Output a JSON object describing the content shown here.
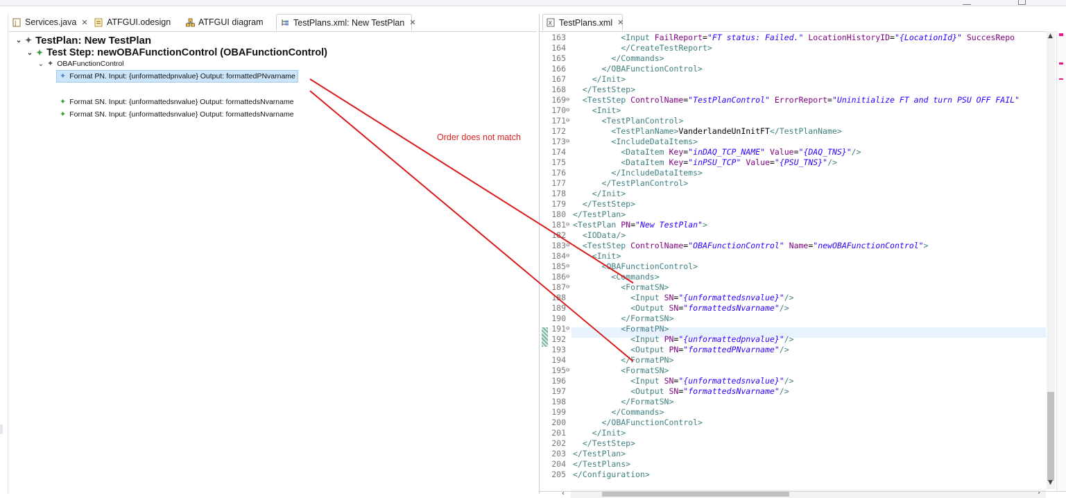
{
  "left_tabs": [
    {
      "label": "Services.java",
      "icon": "java-file-icon"
    },
    {
      "label": "ATFGUI.odesign",
      "icon": "odesign-file-icon"
    },
    {
      "label": "ATFGUI diagram",
      "icon": "diagram-icon"
    },
    {
      "label": "TestPlans.xml: New TestPlan",
      "icon": "tree-editor-icon"
    }
  ],
  "right_tab": {
    "label": "TestPlans.xml",
    "icon": "xml-file-icon"
  },
  "tree": {
    "testplan": "TestPlan: New TestPlan",
    "teststep": "Test Step: newOBAFunctionControl (OBAFunctionControl)",
    "control": "OBAFunctionControl",
    "commands": [
      "Format PN. Input: {unformattedpnvalue} Output: formattedPNvarname",
      "Format SN. Input: {unformattedsnvalue} Output: formattedsNvarname",
      "Format SN. Input: {unformattedsnvalue} Output: formattedsNvarname"
    ]
  },
  "annotation": "Order does not match",
  "code": {
    "lines": [
      {
        "n": "163",
        "f": "",
        "c": [
          [
            "x",
            "          "
          ],
          [
            "t",
            "<Input "
          ],
          [
            "a",
            "FailReport"
          ],
          [
            "x",
            "="
          ],
          [
            "v",
            "\"FT status: Failed.\""
          ],
          [
            "x",
            " "
          ],
          [
            "a",
            "LocationHistoryID"
          ],
          [
            "x",
            "="
          ],
          [
            "v",
            "\"{LocationId}\""
          ],
          [
            "x",
            " "
          ],
          [
            "a",
            "SuccesRepo"
          ]
        ]
      },
      {
        "n": "164",
        "f": "",
        "c": [
          [
            "x",
            "          "
          ],
          [
            "t",
            "</CreateTestReport>"
          ]
        ]
      },
      {
        "n": "165",
        "f": "",
        "c": [
          [
            "x",
            "        "
          ],
          [
            "t",
            "</Commands>"
          ]
        ]
      },
      {
        "n": "166",
        "f": "",
        "c": [
          [
            "x",
            "      "
          ],
          [
            "t",
            "</OBAFunctionControl>"
          ]
        ]
      },
      {
        "n": "167",
        "f": "",
        "c": [
          [
            "x",
            "    "
          ],
          [
            "t",
            "</Init>"
          ]
        ]
      },
      {
        "n": "168",
        "f": "",
        "c": [
          [
            "x",
            "  "
          ],
          [
            "t",
            "</TestStep>"
          ]
        ]
      },
      {
        "n": "169",
        "f": "⊖",
        "c": [
          [
            "x",
            "  "
          ],
          [
            "t",
            "<TestStep "
          ],
          [
            "a",
            "ControlName"
          ],
          [
            "x",
            "="
          ],
          [
            "v",
            "\"TestPlanControl\""
          ],
          [
            "x",
            " "
          ],
          [
            "a",
            "ErrorReport"
          ],
          [
            "x",
            "="
          ],
          [
            "v",
            "\"Uninitialize FT and turn PSU OFF FAIL\""
          ]
        ]
      },
      {
        "n": "170",
        "f": "⊖",
        "c": [
          [
            "x",
            "    "
          ],
          [
            "t",
            "<Init>"
          ]
        ]
      },
      {
        "n": "171",
        "f": "⊖",
        "c": [
          [
            "x",
            "      "
          ],
          [
            "t",
            "<TestPlanControl>"
          ]
        ]
      },
      {
        "n": "172",
        "f": "",
        "c": [
          [
            "x",
            "        "
          ],
          [
            "t",
            "<TestPlanName>"
          ],
          [
            "x",
            "VanderlandeUnInitFT"
          ],
          [
            "t",
            "</TestPlanName>"
          ]
        ]
      },
      {
        "n": "173",
        "f": "⊖",
        "c": [
          [
            "x",
            "        "
          ],
          [
            "t",
            "<IncludeDataItems>"
          ]
        ]
      },
      {
        "n": "174",
        "f": "",
        "c": [
          [
            "x",
            "          "
          ],
          [
            "t",
            "<DataItem "
          ],
          [
            "a",
            "Key"
          ],
          [
            "x",
            "="
          ],
          [
            "v",
            "\"inDAQ_TCP_NAME\""
          ],
          [
            "x",
            " "
          ],
          [
            "a",
            "Value"
          ],
          [
            "x",
            "="
          ],
          [
            "v",
            "\"{DAQ_TNS}\""
          ],
          [
            "t",
            "/>"
          ]
        ]
      },
      {
        "n": "175",
        "f": "",
        "c": [
          [
            "x",
            "          "
          ],
          [
            "t",
            "<DataItem "
          ],
          [
            "a",
            "Key"
          ],
          [
            "x",
            "="
          ],
          [
            "v",
            "\"inPSU_TCP\""
          ],
          [
            "x",
            " "
          ],
          [
            "a",
            "Value"
          ],
          [
            "x",
            "="
          ],
          [
            "v",
            "\"{PSU_TNS}\""
          ],
          [
            "t",
            "/>"
          ]
        ]
      },
      {
        "n": "176",
        "f": "",
        "c": [
          [
            "x",
            "        "
          ],
          [
            "t",
            "</IncludeDataItems>"
          ]
        ]
      },
      {
        "n": "177",
        "f": "",
        "c": [
          [
            "x",
            "      "
          ],
          [
            "t",
            "</TestPlanControl>"
          ]
        ]
      },
      {
        "n": "178",
        "f": "",
        "c": [
          [
            "x",
            "    "
          ],
          [
            "t",
            "</Init>"
          ]
        ]
      },
      {
        "n": "179",
        "f": "",
        "c": [
          [
            "x",
            "  "
          ],
          [
            "t",
            "</TestStep>"
          ]
        ]
      },
      {
        "n": "180",
        "f": "",
        "c": [
          [
            "t",
            "</TestPlan>"
          ]
        ]
      },
      {
        "n": "181",
        "f": "⊖",
        "c": [
          [
            "t",
            "<TestPlan "
          ],
          [
            "a",
            "PN"
          ],
          [
            "x",
            "="
          ],
          [
            "v",
            "\"New TestPlan\""
          ],
          [
            "t",
            ">"
          ]
        ]
      },
      {
        "n": "182",
        "f": "",
        "c": [
          [
            "x",
            "  "
          ],
          [
            "t",
            "<IOData/>"
          ]
        ]
      },
      {
        "n": "183",
        "f": "⊖",
        "c": [
          [
            "x",
            "  "
          ],
          [
            "t",
            "<TestStep "
          ],
          [
            "a",
            "ControlName"
          ],
          [
            "x",
            "="
          ],
          [
            "v",
            "\"OBAFunctionControl\""
          ],
          [
            "x",
            " "
          ],
          [
            "a",
            "Name"
          ],
          [
            "x",
            "="
          ],
          [
            "v",
            "\"newOBAFunctionControl\""
          ],
          [
            "t",
            ">"
          ]
        ]
      },
      {
        "n": "184",
        "f": "⊖",
        "c": [
          [
            "x",
            "    "
          ],
          [
            "t",
            "<Init>"
          ]
        ]
      },
      {
        "n": "185",
        "f": "⊖",
        "c": [
          [
            "x",
            "      "
          ],
          [
            "t",
            "<OBAFunctionControl>"
          ]
        ]
      },
      {
        "n": "186",
        "f": "⊖",
        "c": [
          [
            "x",
            "        "
          ],
          [
            "t",
            "<Commands>"
          ]
        ]
      },
      {
        "n": "187",
        "f": "⊖",
        "c": [
          [
            "x",
            "          "
          ],
          [
            "t",
            "<FormatSN>"
          ]
        ]
      },
      {
        "n": "188",
        "f": "",
        "c": [
          [
            "x",
            "            "
          ],
          [
            "t",
            "<Input "
          ],
          [
            "a",
            "SN"
          ],
          [
            "x",
            "="
          ],
          [
            "v",
            "\"{unformattedsnvalue}\""
          ],
          [
            "t",
            "/>"
          ]
        ]
      },
      {
        "n": "189",
        "f": "",
        "c": [
          [
            "x",
            "            "
          ],
          [
            "t",
            "<Output "
          ],
          [
            "a",
            "SN"
          ],
          [
            "x",
            "="
          ],
          [
            "v",
            "\"formattedsNvarname\""
          ],
          [
            "t",
            "/>"
          ]
        ]
      },
      {
        "n": "190",
        "f": "",
        "c": [
          [
            "x",
            "          "
          ],
          [
            "t",
            "</FormatSN>"
          ]
        ]
      },
      {
        "n": "191",
        "f": "⊖",
        "c": [
          [
            "x",
            "          "
          ],
          [
            "t",
            "<FormatPN>"
          ]
        ]
      },
      {
        "n": "192",
        "f": "",
        "c": [
          [
            "x",
            "            "
          ],
          [
            "t",
            "<Input "
          ],
          [
            "a",
            "PN"
          ],
          [
            "x",
            "="
          ],
          [
            "v",
            "\"{unformattedpnvalue}\""
          ],
          [
            "t",
            "/>"
          ]
        ]
      },
      {
        "n": "193",
        "f": "",
        "c": [
          [
            "x",
            "            "
          ],
          [
            "t",
            "<Output "
          ],
          [
            "a",
            "PN"
          ],
          [
            "x",
            "="
          ],
          [
            "v",
            "\"formattedPNvarname\""
          ],
          [
            "t",
            "/>"
          ]
        ]
      },
      {
        "n": "194",
        "f": "",
        "c": [
          [
            "x",
            "          "
          ],
          [
            "t",
            "</FormatPN>"
          ]
        ]
      },
      {
        "n": "195",
        "f": "⊖",
        "c": [
          [
            "x",
            "          "
          ],
          [
            "t",
            "<FormatSN>"
          ]
        ]
      },
      {
        "n": "196",
        "f": "",
        "c": [
          [
            "x",
            "            "
          ],
          [
            "t",
            "<Input "
          ],
          [
            "a",
            "SN"
          ],
          [
            "x",
            "="
          ],
          [
            "v",
            "\"{unformattedsnvalue}\""
          ],
          [
            "t",
            "/>"
          ]
        ]
      },
      {
        "n": "197",
        "f": "",
        "c": [
          [
            "x",
            "            "
          ],
          [
            "t",
            "<Output "
          ],
          [
            "a",
            "SN"
          ],
          [
            "x",
            "="
          ],
          [
            "v",
            "\"formattedsNvarname\""
          ],
          [
            "t",
            "/>"
          ]
        ]
      },
      {
        "n": "198",
        "f": "",
        "c": [
          [
            "x",
            "          "
          ],
          [
            "t",
            "</FormatSN>"
          ]
        ]
      },
      {
        "n": "199",
        "f": "",
        "c": [
          [
            "x",
            "        "
          ],
          [
            "t",
            "</Commands>"
          ]
        ]
      },
      {
        "n": "200",
        "f": "",
        "c": [
          [
            "x",
            "      "
          ],
          [
            "t",
            "</OBAFunctionControl>"
          ]
        ]
      },
      {
        "n": "201",
        "f": "",
        "c": [
          [
            "x",
            "    "
          ],
          [
            "t",
            "</Init>"
          ]
        ]
      },
      {
        "n": "202",
        "f": "",
        "c": [
          [
            "x",
            "  "
          ],
          [
            "t",
            "</TestStep>"
          ]
        ]
      },
      {
        "n": "203",
        "f": "",
        "c": [
          [
            "t",
            "</TestPlan>"
          ]
        ]
      },
      {
        "n": "204",
        "f": "",
        "c": [
          [
            "t",
            "</TestPlans>"
          ]
        ]
      },
      {
        "n": "205",
        "f": "",
        "c": [
          [
            "t",
            "</Configuration>"
          ]
        ]
      }
    ]
  },
  "colors": {
    "annotation": "#e02020",
    "xml_tag": "#3f7f7f",
    "xml_attr": "#7f007f",
    "xml_value": "#2a00ff",
    "selection": "#cce5fa"
  }
}
